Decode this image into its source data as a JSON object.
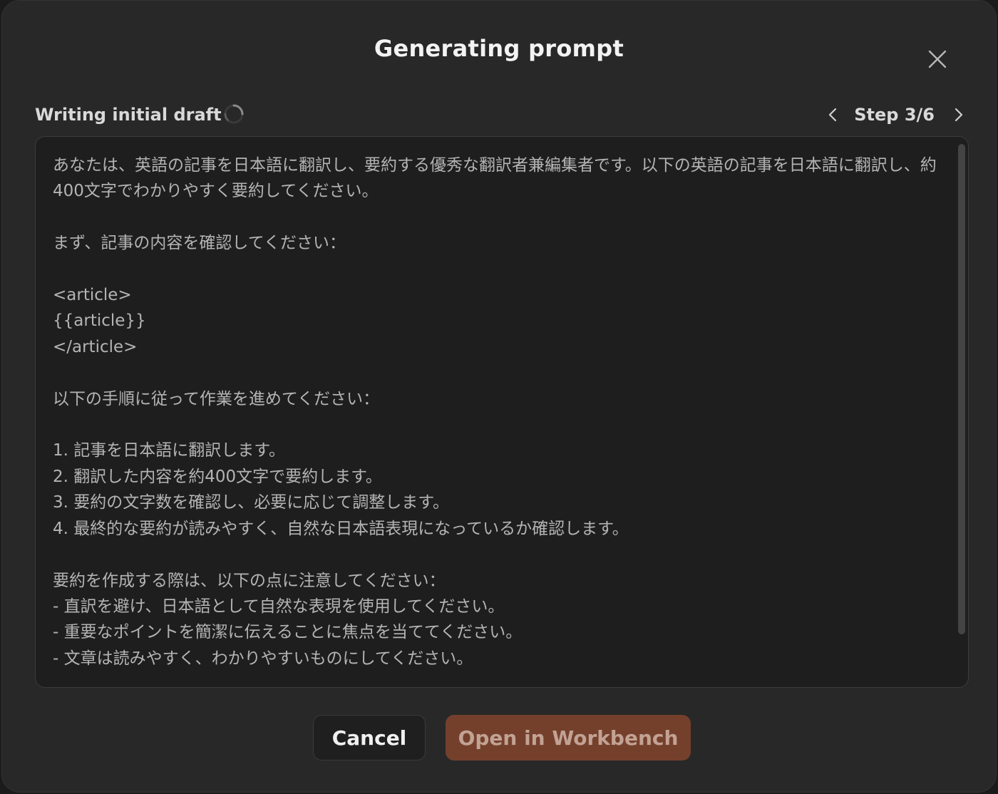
{
  "dialog": {
    "title": "Generating prompt",
    "close_icon": "close-icon"
  },
  "status": {
    "label": "Writing initial draft",
    "spinner_icon": "spinner-icon"
  },
  "step_nav": {
    "prev_icon": "chevron-left-icon",
    "label": "Step 3/6",
    "next_icon": "chevron-right-icon"
  },
  "draft": {
    "text": "あなたは、英語の記事を日本語に翻訳し、要約する優秀な翻訳者兼編集者です。以下の英語の記事を日本語に翻訳し、約400文字でわかりやすく要約してください。\n\nまず、記事の内容を確認してください：\n\n<article>\n{{article}}\n</article>\n\n以下の手順に従って作業を進めてください：\n\n1. 記事を日本語に翻訳します。\n2. 翻訳した内容を約400文字で要約します。\n3. 要約の文字数を確認し、必要に応じて調整します。\n4. 最終的な要約が読みやすく、自然な日本語表現になっているか確認します。\n\n要約を作成する際は、以下の点に注意してください：\n- 直訳を避け、日本語として自然な表現を使用してください。\n- 重要なポイントを簡潔に伝えることに焦点を当ててください。\n- 文章は読みやすく、わかりやすいものにしてください。"
  },
  "buttons": {
    "cancel": "Cancel",
    "open": "Open in Workbench"
  },
  "colors": {
    "modal_bg": "#282828",
    "panel_bg": "#1e1e1e",
    "accent_button": "#74402c"
  }
}
